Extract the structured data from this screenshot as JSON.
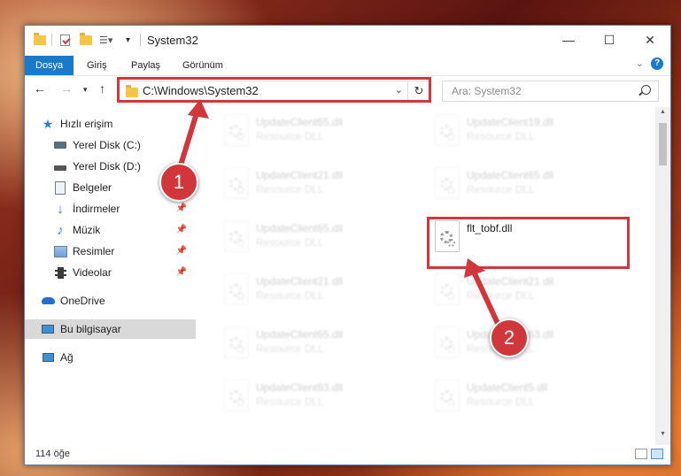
{
  "window": {
    "title": "System32",
    "minimize": "—",
    "maximize": "☐",
    "close": "✕"
  },
  "ribbon": {
    "tabs": [
      "Dosya",
      "Giriş",
      "Paylaş",
      "Görünüm"
    ],
    "help": "?"
  },
  "address": {
    "path": "C:\\Windows\\System32",
    "refresh": "↻"
  },
  "search": {
    "placeholder": "Ara: System32"
  },
  "sidebar": {
    "items": [
      {
        "label": "Hızlı erişim",
        "icon": "star-icon"
      },
      {
        "label": "Yerel Disk (C:)",
        "icon": "drive-c-icon"
      },
      {
        "label": "Yerel Disk (D:)",
        "icon": "drive-d-icon"
      },
      {
        "label": "Belgeler",
        "icon": "documents-icon"
      },
      {
        "label": "İndirmeler",
        "icon": "download-icon"
      },
      {
        "label": "Müzik",
        "icon": "music-icon"
      },
      {
        "label": "Resimler",
        "icon": "pictures-icon"
      },
      {
        "label": "Videolar",
        "icon": "videos-icon"
      },
      {
        "label": "OneDrive",
        "icon": "cloud-icon"
      },
      {
        "label": "Bu bilgisayar",
        "icon": "computer-icon"
      },
      {
        "label": "Ağ",
        "icon": "network-icon"
      }
    ]
  },
  "files": {
    "left": [
      {
        "name": "UpdateClient65.dll",
        "type": "Resource DLL"
      },
      {
        "name": "UpdateClient21.dll",
        "type": "Resource DLL"
      },
      {
        "name": "UpdateClient65.dll",
        "type": "Resource DLL"
      },
      {
        "name": "UpdateClient21.dll",
        "type": "Resource DLL"
      },
      {
        "name": "UpdateClient65.dll",
        "type": "Resource DLL"
      },
      {
        "name": "UpdateClient63.dll",
        "type": "Resource DLL"
      }
    ],
    "right": [
      {
        "name": "UpdateClient19.dll",
        "type": "Resource DLL"
      },
      {
        "name": "UpdateClient65.dll",
        "type": "Resource DLL"
      },
      {
        "name": "flt_tobf.dll",
        "type": ""
      },
      {
        "name": "UpdateClient21.dll",
        "type": "Resource DLL"
      },
      {
        "name": "UpdateClient63.dll",
        "type": "Resource DLL"
      },
      {
        "name": "UpdateClient5.dll",
        "type": "Resource DLL"
      }
    ]
  },
  "status": {
    "count": "114 öğe"
  },
  "annotations": {
    "step1": "1",
    "step2": "2",
    "highlight_color": "#d0363a"
  }
}
